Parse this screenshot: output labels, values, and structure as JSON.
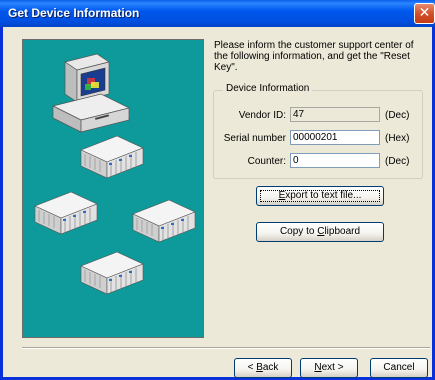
{
  "window": {
    "title": "Get Device Information",
    "close_glyph": "✕"
  },
  "intro_text": "Please inform the customer support center of the following information, and get the \"Reset Key\".",
  "device_info": {
    "legend": "Device Information",
    "vendor_id": {
      "label": "Vendor ID:",
      "value": "47",
      "unit": "(Dec)"
    },
    "serial_number": {
      "label": "Serial number",
      "value": "00000201",
      "unit": "(Hex)"
    },
    "counter": {
      "label": "Counter:",
      "value": "0",
      "unit": "(Dec)"
    }
  },
  "buttons": {
    "export": {
      "pre": "",
      "accel": "E",
      "post": "xport to text file..."
    },
    "copy": {
      "pre": "Copy to ",
      "accel": "C",
      "post": "lipboard"
    },
    "back": {
      "pre": "< ",
      "accel": "B",
      "post": "ack"
    },
    "next": {
      "pre": "",
      "accel": "N",
      "post": "ext >"
    },
    "cancel": {
      "label": "Cancel"
    }
  },
  "colors": {
    "title_bar": "#0058ee",
    "illustration_bg": "#0e9a9a",
    "dialog_bg": "#ece9d8"
  },
  "icons": [
    "computer-icon",
    "plc-device-icon",
    "close-icon"
  ]
}
